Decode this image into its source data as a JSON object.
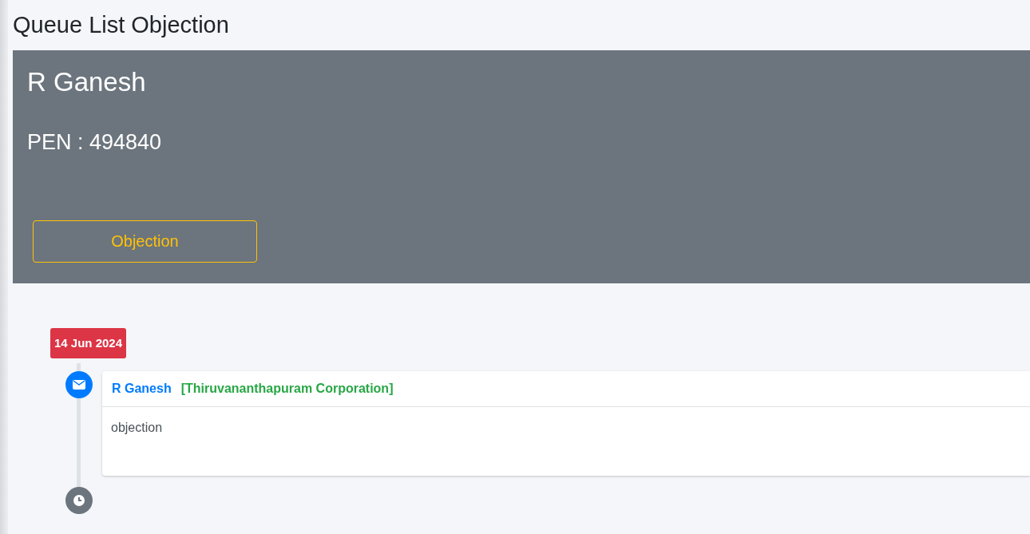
{
  "page_title": "Queue List Objection",
  "profile": {
    "name": "R Ganesh",
    "pen": "PEN : 494840",
    "button": "Objection"
  },
  "timeline": {
    "date": "14 Jun 2024",
    "items": [
      {
        "kind": "message",
        "author": "R Ganesh",
        "office": "[Thiruvananthapuram Corporation]",
        "body": "objection"
      },
      {
        "kind": "clock"
      }
    ]
  }
}
